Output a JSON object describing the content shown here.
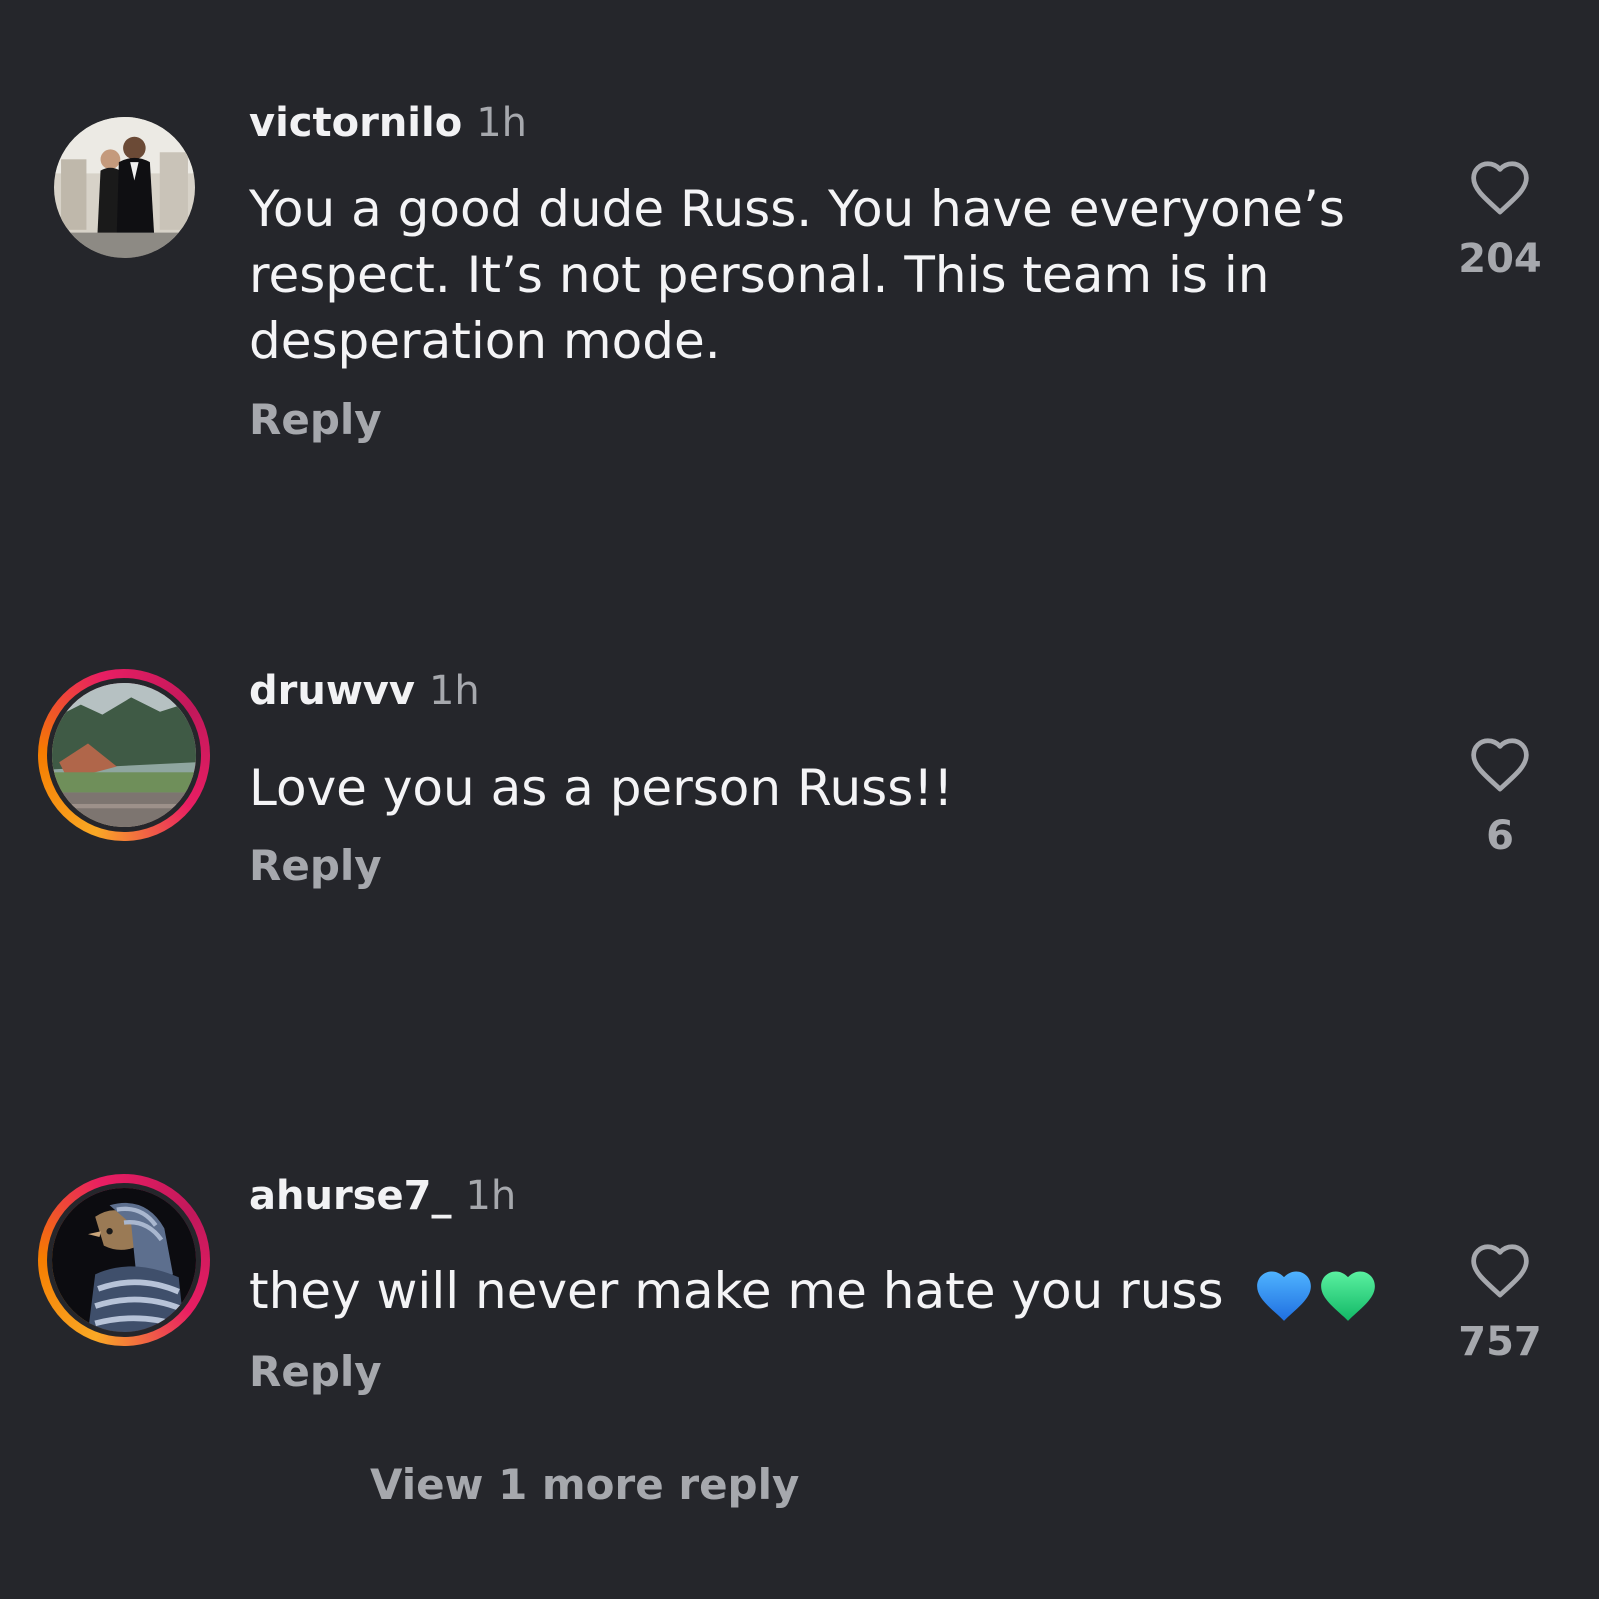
{
  "comments": [
    {
      "username": "victornilo",
      "time": "1h",
      "text": "You a good dude Russ. You have everyone’s respect. It’s not personal. This team is in desperation mode.",
      "reply_label": "Reply",
      "likes": "204",
      "has_story_ring": false
    },
    {
      "username": "druwvv",
      "time": "1h",
      "text": "Love you as a person Russ!!",
      "reply_label": "Reply",
      "likes": "6",
      "has_story_ring": true
    },
    {
      "username": "ahurse7_",
      "time": "1h",
      "text": "they will never make me hate you russ",
      "emojis": [
        "blue-heart-icon",
        "green-heart-icon"
      ],
      "reply_label": "Reply",
      "likes": "757",
      "has_story_ring": true
    }
  ],
  "view_more_label": "View 1 more reply",
  "colors": {
    "background": "#25262b",
    "primary_text": "#f4f4f6",
    "secondary_text": "#a6a8ad",
    "blue_heart": "#2d8cf0",
    "green_heart": "#1ed67a"
  }
}
